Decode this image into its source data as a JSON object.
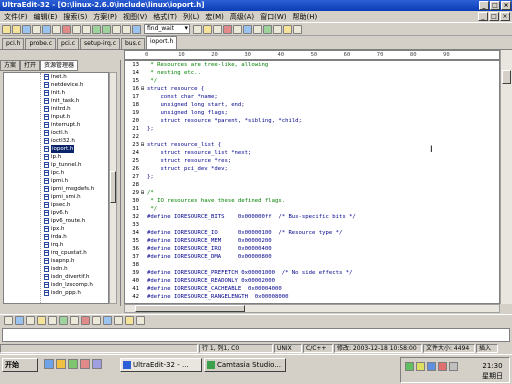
{
  "window": {
    "title": "UltraEdit-32 - [O:\\linux-2.6.0\\include\\linux\\ioport.h]",
    "btn_min": "_",
    "btn_max": "□",
    "btn_close": "×"
  },
  "menu": {
    "items": [
      "文件(F)",
      "编辑(E)",
      "搜索(S)",
      "方案(P)",
      "视图(V)",
      "格式(T)",
      "列(L)",
      "宏(M)",
      "高级(A)",
      "窗口(W)",
      "帮助(H)"
    ]
  },
  "toolbar": {
    "function_select": "find_wait"
  },
  "file_tabs": [
    "pci.h",
    "probe.c",
    "pci.c",
    "setup-irq.c",
    "bus.c",
    "ioport.h"
  ],
  "left_panel": {
    "tabs": [
      "方案",
      "打开",
      "资源管理器"
    ],
    "files": [
      "inet.h",
      "netdevice.h",
      "init.h",
      "init_task.h",
      "initrd.h",
      "input.h",
      "interrupt.h",
      "ioctl.h",
      "ioctl32.h",
      "ioport.h",
      "ip.h",
      "ip_tunnel.h",
      "ipc.h",
      "ipmi.h",
      "ipmi_msgdefs.h",
      "ipmi_smi.h",
      "ipsec.h",
      "ipv6.h",
      "ipv6_route.h",
      "ipx.h",
      "irda.h",
      "irq.h",
      "irq_cpustat.h",
      "isapnp.h",
      "isdn.h",
      "isdn_divertif.h",
      "isdn_lzscomp.h",
      "isdn_ppp.h"
    ],
    "selected": "ioport.h"
  },
  "editor": {
    "ruler": "0         10        20        30        40        50        60        70        80        90",
    "lines": [
      {
        "n": "13",
        "fold": "",
        "text": " * Resources are tree-like, allowing",
        "comment": true
      },
      {
        "n": "14",
        "fold": "",
        "text": " * nesting etc..",
        "comment": true
      },
      {
        "n": "15",
        "fold": "",
        "text": " */",
        "comment": true
      },
      {
        "n": "16",
        "fold": "⊟",
        "text": "struct resource {",
        "comment": false
      },
      {
        "n": "17",
        "fold": "",
        "text": "    const char *name;",
        "comment": false
      },
      {
        "n": "18",
        "fold": "",
        "text": "    unsigned long start, end;",
        "comment": false
      },
      {
        "n": "19",
        "fold": "",
        "text": "    unsigned long flags;",
        "comment": false
      },
      {
        "n": "20",
        "fold": "",
        "text": "    struct resource *parent, *sibling, *child;",
        "comment": false
      },
      {
        "n": "21",
        "fold": "",
        "text": "};",
        "comment": false
      },
      {
        "n": "22",
        "fold": "",
        "text": "",
        "comment": false
      },
      {
        "n": "23",
        "fold": "⊟",
        "text": "struct resource_list {",
        "comment": false
      },
      {
        "n": "24",
        "fold": "",
        "text": "    struct resource_list *next;",
        "comment": false
      },
      {
        "n": "25",
        "fold": "",
        "text": "    struct resource *res;",
        "comment": false
      },
      {
        "n": "26",
        "fold": "",
        "text": "    struct pci_dev *dev;",
        "comment": false
      },
      {
        "n": "27",
        "fold": "",
        "text": "};",
        "comment": false
      },
      {
        "n": "28",
        "fold": "",
        "text": "",
        "comment": false
      },
      {
        "n": "29",
        "fold": "⊟",
        "text": "/*",
        "comment": true
      },
      {
        "n": "30",
        "fold": "",
        "text": " * IO resources have these defined flags.",
        "comment": true
      },
      {
        "n": "31",
        "fold": "",
        "text": " */",
        "comment": true
      },
      {
        "n": "32",
        "fold": "",
        "text": "#define IORESOURCE_BITS    0x000000ff  /* Bus-specific bits */",
        "comment": false
      },
      {
        "n": "33",
        "fold": "",
        "text": "",
        "comment": false
      },
      {
        "n": "34",
        "fold": "",
        "text": "#define IORESOURCE_IO      0x00000100  /* Resource type */",
        "comment": false
      },
      {
        "n": "35",
        "fold": "",
        "text": "#define IORESOURCE_MEM     0x00000200",
        "comment": false
      },
      {
        "n": "36",
        "fold": "",
        "text": "#define IORESOURCE_IRQ     0x00000400",
        "comment": false
      },
      {
        "n": "37",
        "fold": "",
        "text": "#define IORESOURCE_DMA     0x00000800",
        "comment": false
      },
      {
        "n": "38",
        "fold": "",
        "text": "",
        "comment": false
      },
      {
        "n": "39",
        "fold": "",
        "text": "#define IORESOURCE_PREFETCH 0x00001000  /* No side effects */",
        "comment": false
      },
      {
        "n": "40",
        "fold": "",
        "text": "#define IORESOURCE_READONLY 0x00002000",
        "comment": false
      },
      {
        "n": "41",
        "fold": "",
        "text": "#define IORESOURCE_CACHEABLE  0x00004000",
        "comment": false
      },
      {
        "n": "42",
        "fold": "",
        "text": "#define IORESOURCE_RANGELENGTH  0x00008000",
        "comment": false
      }
    ]
  },
  "status": {
    "position": "行 1, 列1, C0",
    "line_ending": "UNIX",
    "language": "C/C++",
    "modified": "修改: 2003-12-18 10:58:00",
    "filesize": "文件大小: 4494",
    "mode": "插入"
  },
  "taskbar": {
    "start": "开始",
    "tasks": [
      "UltraEdit-32 - ...",
      "Camtasia Studio..."
    ],
    "time": "21:30",
    "day": "星期日"
  }
}
